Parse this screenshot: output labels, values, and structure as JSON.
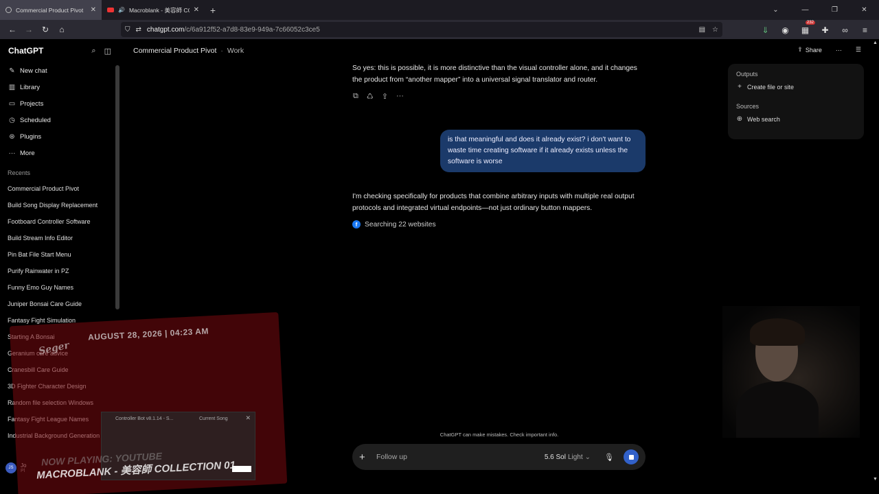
{
  "browser": {
    "tabs": [
      {
        "label": "Commercial Product Pivot",
        "active": true
      },
      {
        "label": "Macroblank - 美容師 COLLE",
        "active": false
      }
    ],
    "url_host": "chatgpt.com",
    "url_path": "/c/6a912f52-a7d8-83e9-949a-7c66052c3ce5",
    "extension_badge": "232"
  },
  "sidebar": {
    "brand": "ChatGPT",
    "items": [
      {
        "label": "New chat",
        "icon": "edit-icon"
      },
      {
        "label": "Library",
        "icon": "library-icon"
      },
      {
        "label": "Projects",
        "icon": "folder-icon"
      },
      {
        "label": "Scheduled",
        "icon": "clock-icon"
      },
      {
        "label": "Plugins",
        "icon": "plugin-icon"
      },
      {
        "label": "More",
        "icon": "more-icon"
      }
    ],
    "recents_title": "Recents",
    "recents": [
      "Commercial Product Pivot",
      "Build Song Display Replacement",
      "Footboard Controller Software",
      "Build Stream Info Editor",
      "Pin Bat File Start Menu",
      "Purify Rainwater in PZ",
      "Funny Emo Guy Names",
      "Juniper Bonsai Care Guide",
      "Fantasy Fight Simulation",
      "Starting A Bonsai",
      "Geranium care advice",
      "Cranesbill Care Guide",
      "3D Fighter Character Design",
      "Random file selection Windows",
      "Fantasy Fight League Names",
      "Industrial Background Generation"
    ],
    "user_initials": "JS",
    "user_name": "Jo",
    "user_plan": "Pl"
  },
  "conversation": {
    "title": "Commercial Product Pivot",
    "separator": "·",
    "project": "Work",
    "share_label": "Share",
    "assistant_msg_1": "So yes: this is possible, it is more distinctive than the visual controller alone, and it changes the product from “another mapper” into a universal signal translator and router.",
    "user_msg": "is that meaningful and does it already exist? i don't want to waste time creating software if it already exists unless the software is worse",
    "assistant_msg_2": "I'm checking specifically for products that combine arbitrary inputs with multiple real output protocols and integrated virtual endpoints—not just ordinary button mappers.",
    "searching_label": "Searching 22 websites"
  },
  "panel": {
    "outputs_title": "Outputs",
    "create_label": "Create file or site",
    "sources_title": "Sources",
    "web_search_label": "Web search"
  },
  "composer": {
    "disclaimer": "ChatGPT can make mistakes. Check important info.",
    "placeholder": "Follow up",
    "model_name": "5.6 Sol",
    "model_mode": "Light"
  },
  "overlay": {
    "date": "AUGUST 28, 2026 | 04:23 AM",
    "signature": "Seger",
    "now_playing": "NOW PLAYING: YOUTUBE",
    "track": "MACROBLANK - 美容師 COLLECTION 01",
    "mini_title_1": "Controller Bot v8.1.14 - S...",
    "mini_title_2": "Current Song"
  }
}
